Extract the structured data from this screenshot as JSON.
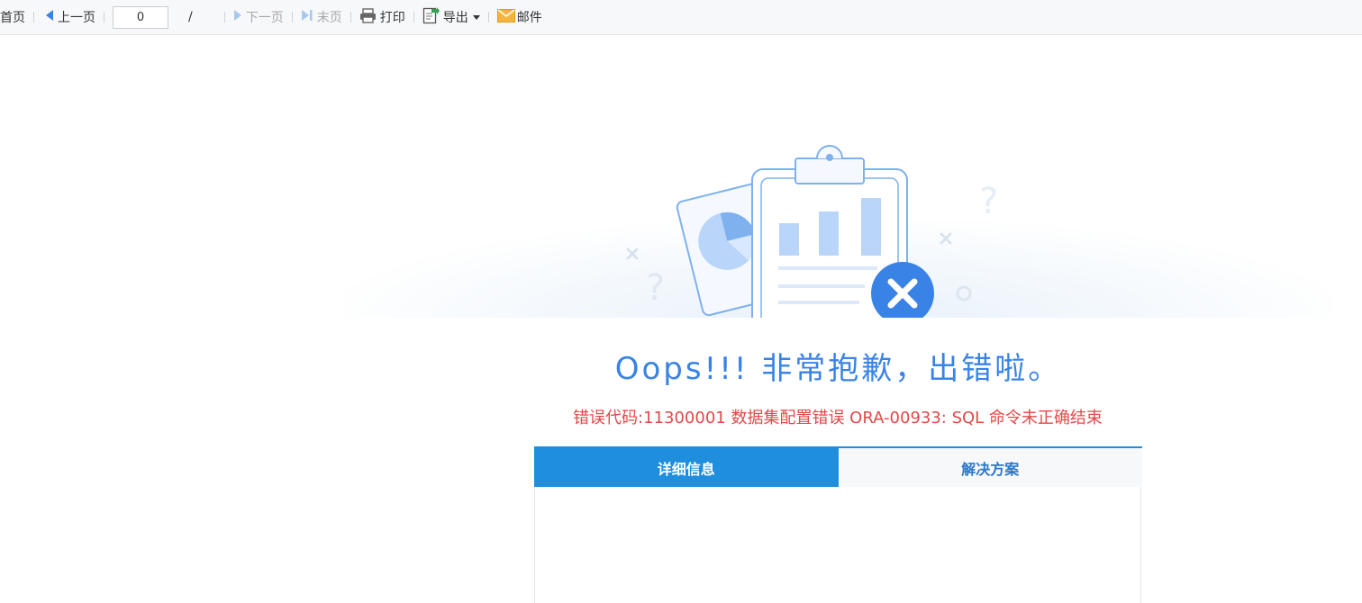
{
  "toolbar": {
    "first_page": "首页",
    "prev_page": "上一页",
    "page_input_value": "0",
    "page_separator": "/",
    "next_page": "下一页",
    "last_page": "末页",
    "print": "打印",
    "export": "导出",
    "mail": "邮件"
  },
  "error": {
    "title": "Oops!!! 非常抱歉，出错啦。",
    "code_message": "错误代码:11300001 数据集配置错误 ORA-00933: SQL 命令未正确结束"
  },
  "tabs": [
    {
      "label": "详细信息",
      "active": true
    },
    {
      "label": "解决方案",
      "active": false
    }
  ],
  "colors": {
    "accent": "#1f8edc",
    "title": "#3a83e6",
    "error": "#e34848",
    "tab_inactive_text": "#2b78c7"
  },
  "icons": {
    "prev": "triangle-left-icon",
    "next": "triangle-right-icon",
    "last": "skip-end-icon",
    "print": "printer-icon",
    "export": "export-icon",
    "mail": "envelope-icon",
    "illustration": "clipboard-chart-error-illustration"
  }
}
